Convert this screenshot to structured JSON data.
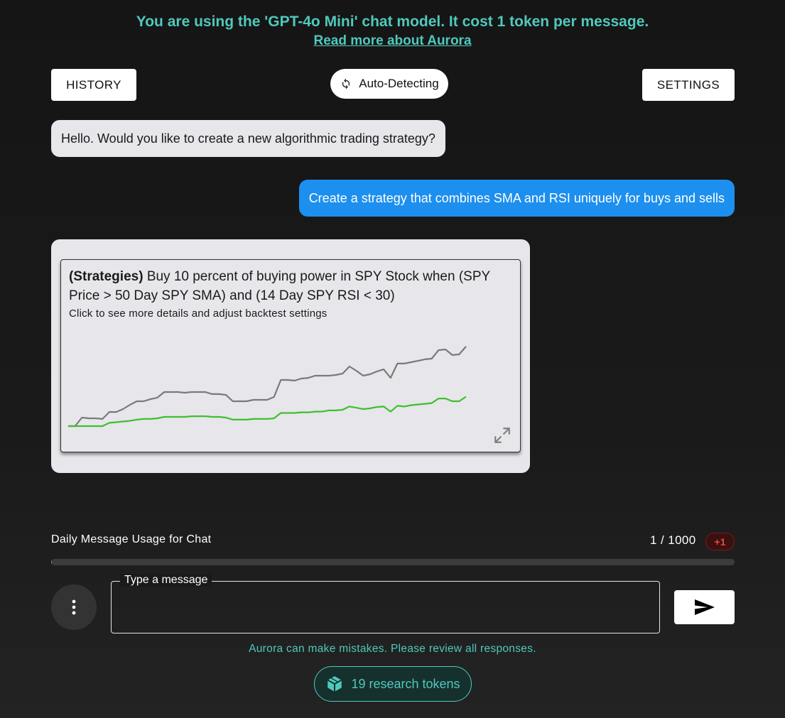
{
  "banner": {
    "line": "You are using the 'GPT-4o Mini' chat model. It cost 1 token per message.",
    "link": "Read more about Aurora"
  },
  "toolbar": {
    "history_label": "HISTORY",
    "auto_detect_label": "Auto-Detecting",
    "settings_label": "SETTINGS"
  },
  "messages": {
    "bot_greeting": "Hello. Would you like to create a new algorithmic trading strategy?",
    "user_message": "Create a strategy that combines SMA and RSI uniquely for buys and sells"
  },
  "strategy": {
    "tag": "(Strategies)",
    "description": "Buy 10 percent of buying power in SPY Stock when (SPY Price > 50 Day SPY SMA) and (14 Day SPY RSI < 30)",
    "subtitle": "Click to see more details and adjust backtest settings"
  },
  "chart_data": {
    "type": "line",
    "series": [
      {
        "color": "#7a7a7a",
        "values": [
          0,
          0,
          5,
          4.6,
          4.6,
          4.2,
          8.3,
          8.3,
          10,
          12.5,
          14.6,
          14.6,
          15.8,
          16.7,
          20,
          20,
          20,
          19.6,
          20,
          20,
          20,
          18.8,
          18.8,
          18.3,
          14.6,
          14.6,
          14.6,
          15.4,
          15.4,
          15.4,
          17.1,
          27.1,
          27.1,
          26.7,
          27.9,
          28.3,
          29.6,
          29.6,
          29.6,
          30,
          30.8,
          35,
          32.5,
          29.6,
          30.4,
          32.1,
          33.3,
          28.3,
          36.7,
          36.7,
          37.5,
          38.3,
          39.2,
          39.6,
          44.6,
          45,
          41.7,
          42.1,
          46.7
        ]
      },
      {
        "color": "#3fbf2f",
        "values": [
          0,
          0,
          0,
          0,
          0,
          0,
          1.9,
          2.3,
          2.7,
          3.1,
          3.8,
          4.2,
          4.2,
          4.6,
          5.4,
          5.4,
          5.4,
          5.4,
          5.8,
          5.8,
          5.8,
          5.4,
          5.4,
          5,
          3.8,
          3.8,
          3.8,
          4.2,
          4.2,
          4.2,
          4.6,
          7.7,
          7.7,
          7.7,
          8.1,
          8.1,
          8.5,
          8.5,
          9.2,
          9.2,
          9.6,
          11.5,
          10.8,
          10,
          10.4,
          11.2,
          11.5,
          8.5,
          11.9,
          11.5,
          12.3,
          12.7,
          13.1,
          13.5,
          16.2,
          16.2,
          14.6,
          14.6,
          17.3
        ]
      }
    ],
    "grid": false,
    "legend": "none"
  },
  "usage": {
    "label": "Daily Message Usage for Chat",
    "count": "1 / 1000",
    "badge": "+1",
    "progress_fraction": 0.001
  },
  "composer": {
    "legend": "Type a message",
    "value": ""
  },
  "footer": {
    "disclaimer": "Aurora can make mistakes. Please review all responses.",
    "tokens_label": "19 research tokens"
  },
  "colors": {
    "accent": "#4fc9bd",
    "user_bubble": "#1d8fef",
    "bot_bubble": "#e7e6ea",
    "badge_red": "#e24a4a"
  },
  "icons": {
    "auto_detect": "refresh-icon",
    "expand": "expand-icon",
    "menu": "kebab-menu-icon",
    "send": "send-icon",
    "tokens": "cube-icon"
  }
}
